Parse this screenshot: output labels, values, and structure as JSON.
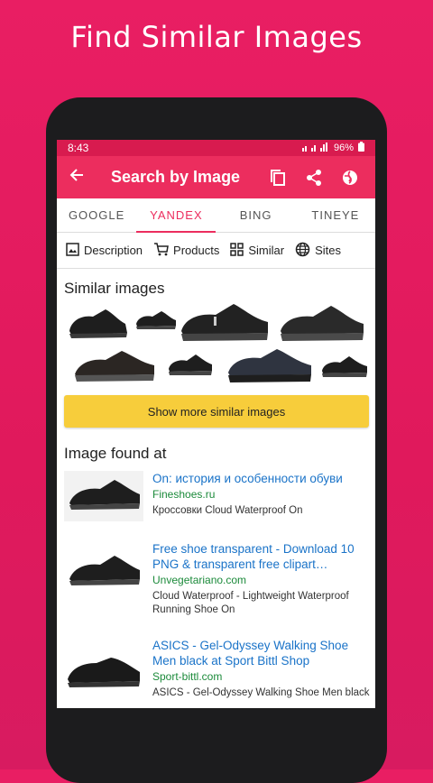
{
  "promo": {
    "title": "Find Similar Images"
  },
  "status": {
    "time": "8:43",
    "battery": "96%"
  },
  "appbar": {
    "title": "Search by Image"
  },
  "tabs": [
    {
      "label": "GOOGLE"
    },
    {
      "label": "YANDEX",
      "active": true
    },
    {
      "label": "BING"
    },
    {
      "label": "TINEYE"
    }
  ],
  "chips": [
    {
      "label": "Description",
      "icon": "image-icon"
    },
    {
      "label": "Products",
      "icon": "cart-icon"
    },
    {
      "label": "Similar",
      "icon": "grid-icon"
    },
    {
      "label": "Sites",
      "icon": "globe-icon"
    }
  ],
  "similar": {
    "title": "Similar images",
    "more_label": "Show more similar images"
  },
  "found": {
    "title": "Image found at"
  },
  "results": [
    {
      "title": "On: история и особенности обуви",
      "site": "Fineshoes.ru",
      "desc": "Кроссовки Cloud Waterproof On"
    },
    {
      "title": "Free shoe transparent - Download 10 PNG & transparent free clipart…",
      "site": "Unvegetariano.com",
      "desc": "Cloud Waterproof - Lightweight Waterproof Running Shoe On"
    },
    {
      "title": "ASICS - Gel-Odyssey Walking Shoe Men black at Sport Bittl Shop",
      "site": "Sport-bittl.com",
      "desc": "ASICS - Gel-Odyssey Walking Shoe Men black"
    }
  ],
  "colors": {
    "primary": "#ec2d5e",
    "link": "#1a73c8",
    "site": "#1b8a3a",
    "button": "#f7cd3b"
  }
}
